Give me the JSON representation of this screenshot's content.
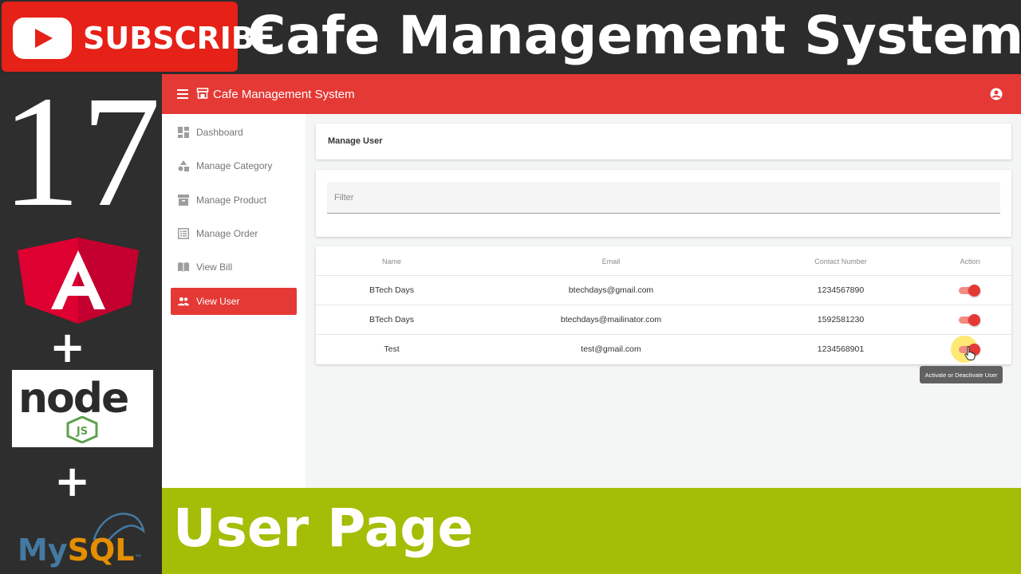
{
  "banner": {
    "subscribe_label": "SUBSCRIBE",
    "title": "Cafe Management System",
    "episode": "17",
    "caption": "User Page",
    "plus": "+",
    "node_wordmark": "node",
    "node_js": "JS",
    "mysql_my": "My",
    "mysql_sql": "SQL",
    "mysql_tm": "™"
  },
  "colors": {
    "toolbar": "#e53935",
    "caption_bar": "#a4bd07",
    "subscribe": "#e62117"
  },
  "app": {
    "title": "Cafe Management System",
    "icons": {
      "menu": "menu-icon",
      "store": "store-icon",
      "account": "account-circle-icon"
    }
  },
  "sidebar": {
    "items": [
      {
        "label": "Dashboard",
        "icon": "dashboard-icon",
        "active": false
      },
      {
        "label": "Manage Category",
        "icon": "category-icon",
        "active": false
      },
      {
        "label": "Manage Product",
        "icon": "inventory-icon",
        "active": false
      },
      {
        "label": "Manage Order",
        "icon": "list-alt-icon",
        "active": false
      },
      {
        "label": "View Bill",
        "icon": "import-contacts-icon",
        "active": false
      },
      {
        "label": "View User",
        "icon": "people-icon",
        "active": true
      }
    ]
  },
  "page": {
    "heading": "Manage User",
    "filter_placeholder": "Filter"
  },
  "table": {
    "headers": [
      "Name",
      "Email",
      "Contact Number",
      "Action"
    ],
    "rows": [
      {
        "name": "BTech Days",
        "email": "btechdays@gmail.com",
        "contact": "1234567890",
        "active": true
      },
      {
        "name": "BTech Days",
        "email": "btechdays@mailinator.com",
        "contact": "1592581230",
        "active": true
      },
      {
        "name": "Test",
        "email": "test@gmail.com",
        "contact": "1234568901",
        "active": true
      }
    ]
  },
  "tooltip": "Activate or Deactivate User"
}
